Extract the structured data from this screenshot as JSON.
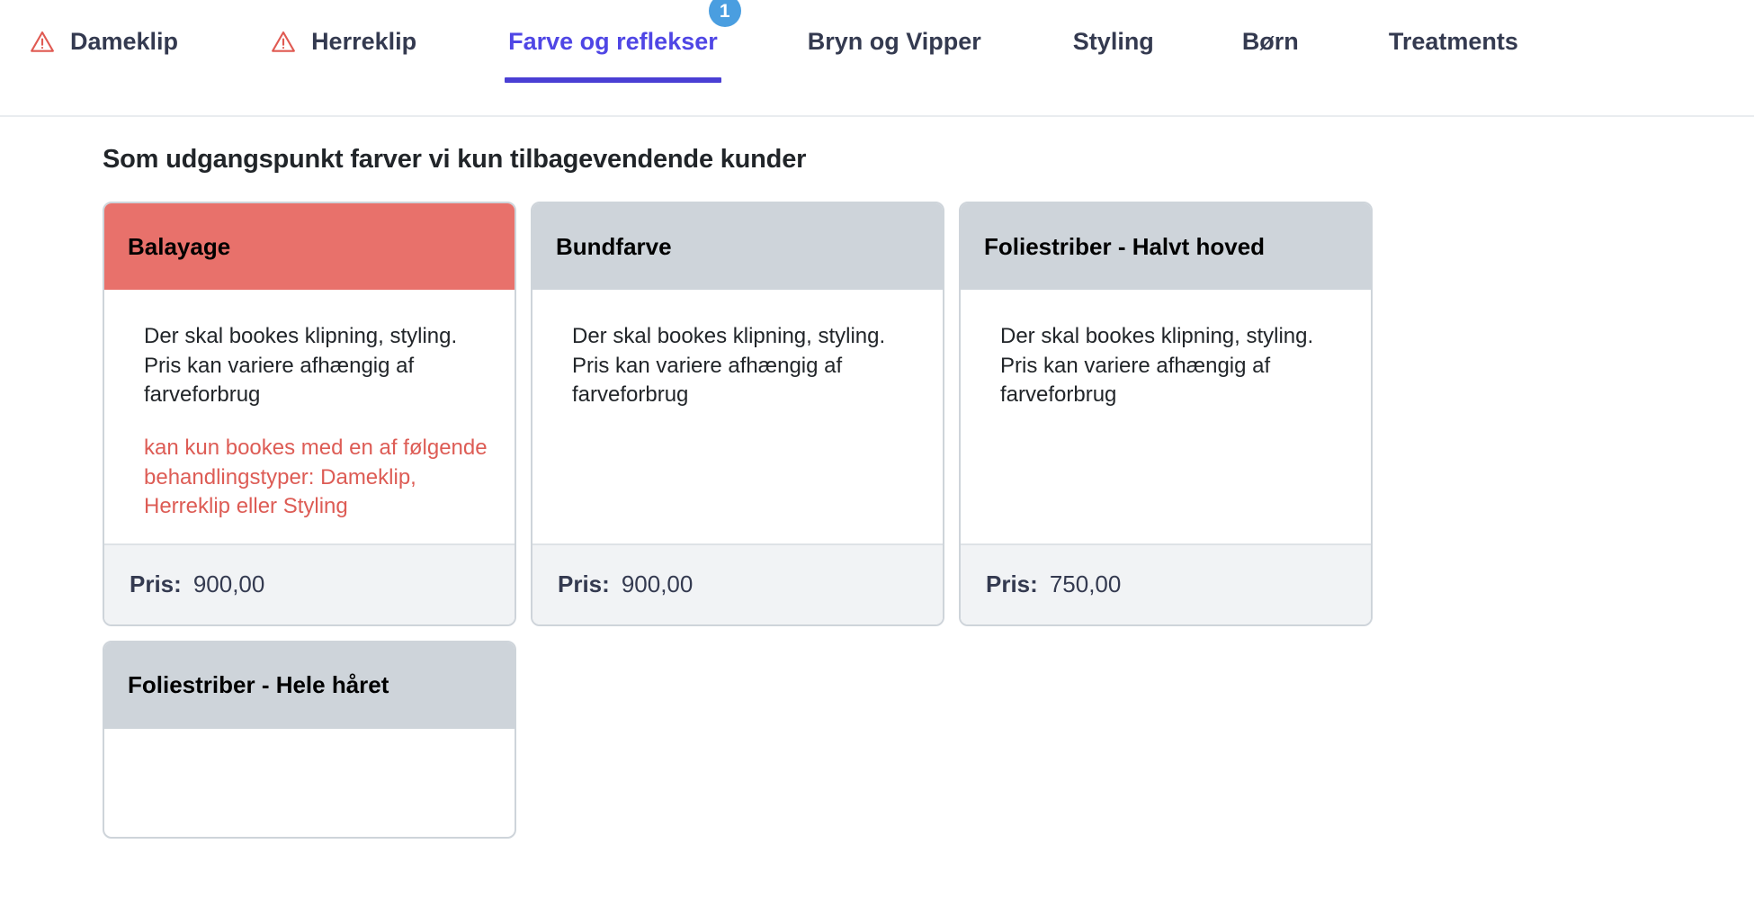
{
  "colors": {
    "accent": "#4f46e5",
    "underline": "#4a3fd4",
    "badge": "#4a9ee0",
    "danger_header": "#e8716b",
    "danger_text": "#dd5c55",
    "neutral_header": "#ced4da",
    "footer_bg": "#f1f3f5",
    "border": "#ced4da"
  },
  "tabs": [
    {
      "label": "Dameklip",
      "icon": "warning-triangle-icon",
      "active": false,
      "badge": null
    },
    {
      "label": "Herreklip",
      "icon": "warning-triangle-icon",
      "active": false,
      "badge": null
    },
    {
      "label": "Farve og reflekser",
      "icon": null,
      "active": true,
      "badge": "1"
    },
    {
      "label": "Bryn og Vipper",
      "icon": null,
      "active": false,
      "badge": null
    },
    {
      "label": "Styling",
      "icon": null,
      "active": false,
      "badge": null
    },
    {
      "label": "Børn",
      "icon": null,
      "active": false,
      "badge": null
    },
    {
      "label": "Treatments",
      "icon": null,
      "active": false,
      "badge": null
    }
  ],
  "main": {
    "section_title": "Som udgangspunkt farver vi kun tilbagevendende kunder",
    "price_label": "Pris:",
    "cards": [
      {
        "title": "Balayage",
        "header_variant": "danger",
        "description": "Der skal bookes klipning, styling. Pris kan variere afhængig af farveforbrug",
        "warning": "kan kun bookes med en af følgende behandlingstyper: Dameklip, Herreklip eller Styling",
        "price": "900,00"
      },
      {
        "title": "Bundfarve",
        "header_variant": "neutral",
        "description": "Der skal bookes klipning, styling. Pris kan variere afhængig af farveforbrug",
        "warning": null,
        "price": "900,00"
      },
      {
        "title": "Foliestriber - Halvt hoved",
        "header_variant": "neutral",
        "description": "Der skal bookes klipning, styling. Pris kan variere afhængig af farveforbrug",
        "warning": null,
        "price": "750,00"
      },
      {
        "title": "Foliestriber - Hele håret",
        "header_variant": "neutral",
        "description": null,
        "warning": null,
        "price": null
      }
    ]
  }
}
